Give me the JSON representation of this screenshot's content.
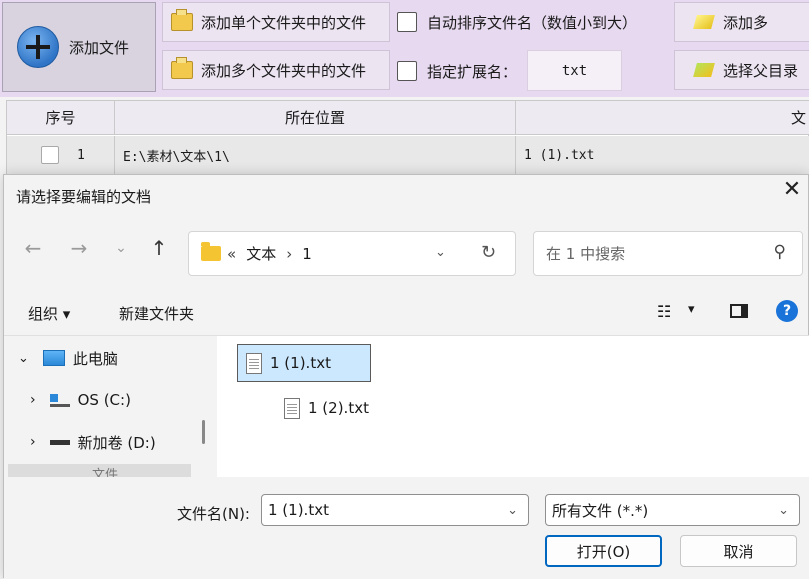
{
  "toolbar": {
    "add_file": "添加文件",
    "add_single_folder": "添加单个文件夹中的文件",
    "add_multi_folder": "添加多个文件夹中的文件",
    "auto_sort": "自动排序文件名（数值小到大）",
    "specify_ext": "指定扩展名：",
    "ext_value": "txt",
    "add_more_partial": "添加多",
    "choose_parent": "选择父目录"
  },
  "grid": {
    "headers": [
      "序号",
      "所在位置",
      "文"
    ],
    "row": {
      "index": "1",
      "location": "E:\\素材\\文本\\1\\",
      "name": "1 (1).txt"
    }
  },
  "dialog": {
    "title": "请选择要编辑的文档",
    "address": {
      "prefix": "«",
      "crumb1": "文本",
      "sep": "›",
      "crumb2": "1"
    },
    "search_placeholder": "在 1 中搜索",
    "organize": "组织",
    "new_folder": "新建文件夹",
    "nav": [
      {
        "label": "此电脑"
      },
      {
        "label": "OS (C:)"
      },
      {
        "label": "新加卷 (D:)"
      },
      {
        "label": "文件..."
      }
    ],
    "files": [
      {
        "name": "1 (1).txt",
        "selected": true
      },
      {
        "name": "1 (2).txt",
        "selected": false
      }
    ],
    "filename_label": "文件名(N):",
    "filename_value": "1 (1).txt",
    "filter_value": "所有文件 (*.*)",
    "open": "打开(O)",
    "cancel": "取消"
  },
  "colors": {
    "accent": "#0067c0",
    "selection": "#cce8ff",
    "toolbar_bg": "#e7d9ef"
  }
}
